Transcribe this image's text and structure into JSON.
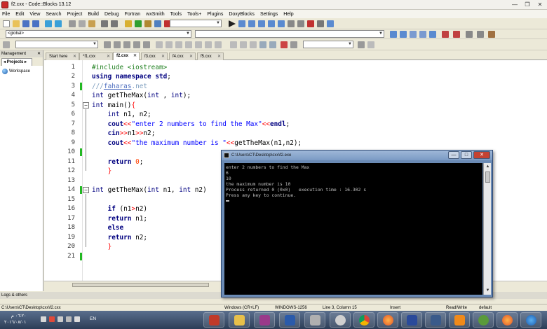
{
  "window": {
    "title": "f2.cxx - Code::Blocks 13.12"
  },
  "menu": [
    "File",
    "Edit",
    "View",
    "Search",
    "Project",
    "Build",
    "Debug",
    "Fortran",
    "wxSmith",
    "Tools",
    "Tools+",
    "Plugins",
    "DoxyBlocks",
    "Settings",
    "Help"
  ],
  "toolbar": {
    "scope_combo": "<global>"
  },
  "management": {
    "title": "Management",
    "tab": "Projects",
    "workspace": "Workspace"
  },
  "tabs": [
    "Start here",
    "*f1.cxx",
    "f2.cxx",
    "f3.cxx",
    "f4.cxx",
    "f5.cxx"
  ],
  "active_tab_index": 2,
  "editor": {
    "line_numbers": [
      "1",
      "2",
      "3",
      "4",
      "5",
      "6",
      "7",
      "8",
      "9",
      "10",
      "11",
      "12",
      "13",
      "14",
      "15",
      "16",
      "17",
      "18",
      "19",
      "20",
      "21"
    ]
  },
  "console": {
    "title": "C:\\Users\\CT\\Desktop\\cxx\\f2.exe",
    "lines": [
      "enter 2 numbers to find the Max",
      "6",
      "10",
      "the maximum number is 10",
      "Process returned 0 (0x0)   execution time : 16.302 s",
      "Press any key to continue."
    ]
  },
  "logs": {
    "title": "Logs & others"
  },
  "status": {
    "path": "C:\\Users\\CT\\Desktop\\cxx\\f2.cxx",
    "eol": "Windows (CR+LF)",
    "encoding": "WINDOWS-1256",
    "position": "Line 3, Column 15",
    "mode": "Insert",
    "access": "Read/Write",
    "profile": "default"
  },
  "taskbar": {
    "time": "٠٦:٢٠ م",
    "date": "٢٠١٦/٠٨/٠١",
    "lang": "EN"
  }
}
